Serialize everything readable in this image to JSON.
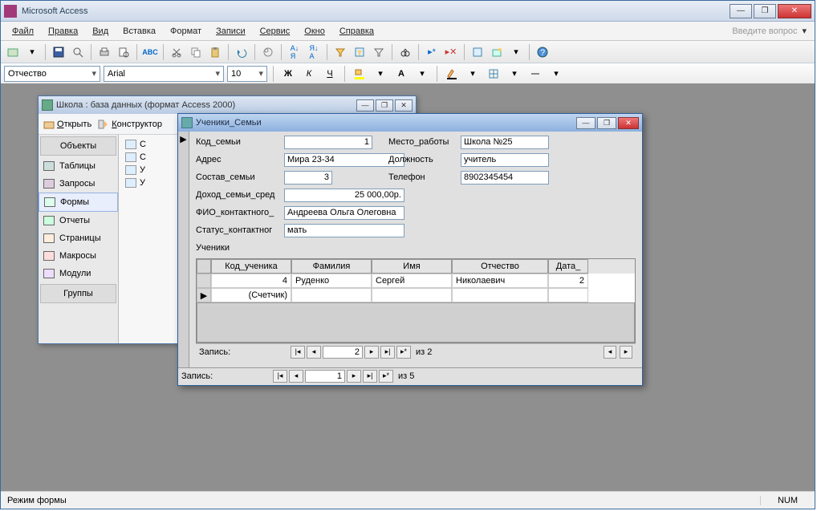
{
  "app": {
    "title": "Microsoft Access"
  },
  "menu": {
    "file": "Файл",
    "edit": "Правка",
    "view": "Вид",
    "insert": "Вставка",
    "format": "Формат",
    "records": "Записи",
    "tools": "Сервис",
    "window": "Окно",
    "help": "Справка",
    "ask": "Введите вопрос"
  },
  "fmtbar": {
    "field": "Отчество",
    "font": "Arial",
    "size": "10"
  },
  "dbwin": {
    "title": "Школа : база данных (формат Access 2000)",
    "open": "Открыть",
    "design": "Конструктор",
    "nav": {
      "objects": "Объекты",
      "tables": "Таблицы",
      "queries": "Запросы",
      "forms": "Формы",
      "reports": "Отчеты",
      "pages": "Страницы",
      "macros": "Макросы",
      "modules": "Модули",
      "groups": "Группы"
    },
    "list": {
      "i1": "С",
      "i2": "С",
      "i3": "У",
      "i4": "У"
    }
  },
  "form": {
    "title": "Ученики_Семьи",
    "labels": {
      "kod": "Код_семьи",
      "addr": "Адрес",
      "sostav": "Состав_семьи",
      "dohod": "Доход_семьи_сред",
      "fio": "ФИО_контактного_",
      "status": "Статус_контактног",
      "sub": "Ученики",
      "work": "Место_работы",
      "dolj": "Должность",
      "tel": "Телефон"
    },
    "values": {
      "kod": "1",
      "addr": "Мира 23-34",
      "sostav": "3",
      "dohod": "25 000,00р.",
      "fio": "Андреева Ольга Олеговна",
      "status": "мать",
      "work": "Школа №25",
      "dolj": "учитель",
      "tel": "8902345454"
    },
    "sub": {
      "cols": {
        "kod": "Код_ученика",
        "fam": "Фамилия",
        "name": "Имя",
        "otch": "Отчество",
        "date": "Дата_"
      },
      "row1": {
        "kod": "4",
        "fam": "Руденко",
        "name": "Сергей",
        "otch": "Николаевич",
        "date": "2"
      },
      "row2": {
        "kod": "(Счетчик)"
      },
      "nav": {
        "lbl": "Запись:",
        "cur": "2",
        "of": "из  2"
      }
    },
    "nav": {
      "lbl": "Запись:",
      "cur": "1",
      "of": "из  5"
    }
  },
  "status": {
    "mode": "Режим формы",
    "num": "NUM"
  }
}
